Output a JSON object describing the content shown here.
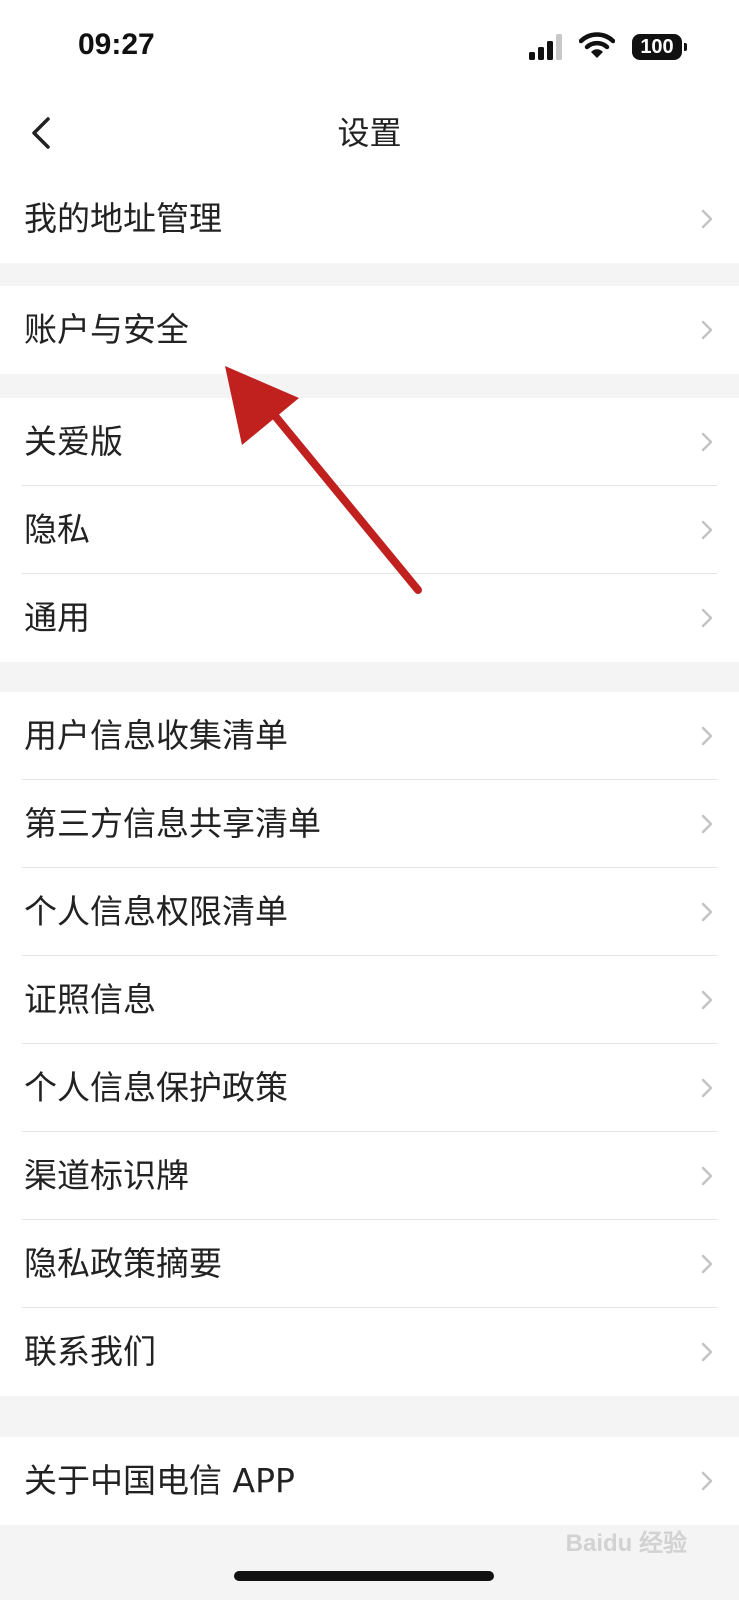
{
  "status_bar": {
    "time": "09:27",
    "battery": "100",
    "icons": [
      "signal-icon",
      "wifi-icon",
      "battery-icon"
    ]
  },
  "nav": {
    "title": "设置",
    "back_icon": "chevron-left-icon"
  },
  "groups": [
    {
      "items": [
        {
          "label": "我的地址管理"
        }
      ]
    },
    {
      "items": [
        {
          "label": "账户与安全"
        }
      ]
    },
    {
      "items": [
        {
          "label": "关爱版"
        },
        {
          "label": "隐私"
        },
        {
          "label": "通用"
        }
      ]
    },
    {
      "items": [
        {
          "label": "用户信息收集清单"
        },
        {
          "label": "第三方信息共享清单"
        },
        {
          "label": "个人信息权限清单"
        },
        {
          "label": "证照信息"
        },
        {
          "label": "个人信息保护政策"
        },
        {
          "label": "渠道标识牌"
        },
        {
          "label": "隐私政策摘要"
        },
        {
          "label": "联系我们"
        }
      ]
    },
    {
      "items": [
        {
          "label": "关于中国电信 APP"
        }
      ]
    }
  ],
  "watermark": "Baidu 经验",
  "colors": {
    "background": "#f4f4f4",
    "card": "#ffffff",
    "text": "#222222",
    "chevron": "#c4c4c4",
    "annotation_arrow": "#c0201e"
  }
}
